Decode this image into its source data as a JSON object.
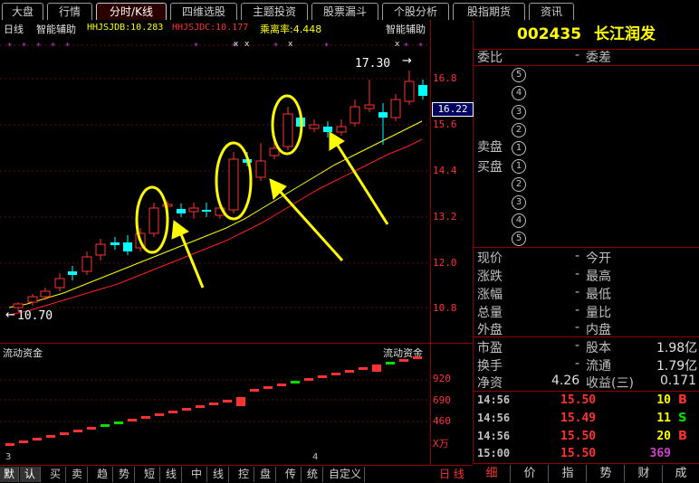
{
  "top_tabs": [
    "大盘",
    "行情",
    "分时/K线",
    "四维选股",
    "主题投资",
    "股票漏斗",
    "个股分析",
    "股指期货",
    "资讯"
  ],
  "chart_header": {
    "period": "日线",
    "indicator": "智能辅助",
    "ma1_label": "HHJSJDB:10.283",
    "ma2_label": "HHJSJDC:10.177",
    "ratio_label": "乘离率:4.448",
    "indicator_right": "智能辅助"
  },
  "price_axis": [
    "16.8",
    "15.6",
    "14.4",
    "13.2",
    "12.0",
    "10.8"
  ],
  "current_price_tag": "16.22",
  "annotations": {
    "high": "17.30",
    "low": "10.70"
  },
  "volume_panel": {
    "title": "流动资金",
    "title_right": "流动资金",
    "axis": [
      "920",
      "690",
      "460"
    ],
    "unit": "X万",
    "x_ticks": [
      "3",
      "4"
    ]
  },
  "bottom_tabs": [
    "默",
    "认",
    "买",
    "卖",
    "趋",
    "势",
    "短",
    "线",
    "中",
    "线",
    "控",
    "盘",
    "传",
    "统",
    "自定义"
  ],
  "bottom_right_label": "日 线",
  "stock": {
    "code": "002435",
    "name": "长江润发"
  },
  "order_book": {
    "left_label": "委比",
    "right_label": "委差",
    "sell_label": "卖盘",
    "buy_label": "买盘",
    "sell_levels": [
      "5",
      "4",
      "3",
      "2",
      "1"
    ],
    "buy_levels": [
      "1",
      "2",
      "3",
      "4",
      "5"
    ]
  },
  "quote_rows": [
    {
      "l": "现价",
      "r": "今开"
    },
    {
      "l": "涨跌",
      "r": "最高"
    },
    {
      "l": "涨幅",
      "r": "最低"
    },
    {
      "l": "总量",
      "r": "量比"
    },
    {
      "l": "外盘",
      "r": "内盘"
    }
  ],
  "fundamentals": [
    {
      "l": "市盈",
      "lv": "",
      "r": "股本",
      "rv": "1.98亿"
    },
    {
      "l": "换手",
      "lv": "",
      "r": "流通",
      "rv": "1.79亿"
    },
    {
      "l": "净资",
      "lv": "4.26",
      "r": "收益(三)",
      "rv": "0.171"
    }
  ],
  "ticks": [
    {
      "time": "14:56",
      "price": "15.50",
      "vol": "10",
      "dir": "B",
      "vol_color": "#ffff00",
      "dir_color": "#ff3232"
    },
    {
      "time": "14:56",
      "price": "15.49",
      "vol": "11",
      "dir": "S",
      "vol_color": "#ffff00",
      "dir_color": "#00e000"
    },
    {
      "time": "14:56",
      "price": "15.50",
      "vol": "20",
      "dir": "B",
      "vol_color": "#ffff00",
      "dir_color": "#ff3232"
    },
    {
      "time": "15:00",
      "price": "15.50",
      "vol": "369",
      "dir": "",
      "vol_color": "#d040d0",
      "dir_color": "#ff3232"
    }
  ],
  "right_tabs": [
    "细",
    "价",
    "指",
    "势",
    "财",
    "成"
  ],
  "colors": {
    "up": "#ff3232",
    "down": "#00ffff",
    "ma_yellow": "#ffff00",
    "ma_red": "#ff2020",
    "volume_down": "#00e000"
  }
}
